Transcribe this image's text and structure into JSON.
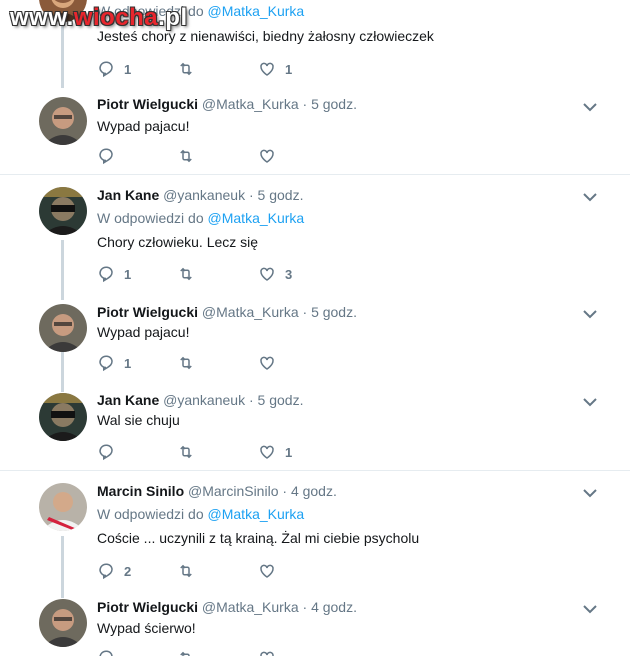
{
  "watermark": {
    "prefix": "www.",
    "accent": "wiocha",
    "suffix": ".pl"
  },
  "top_partial": {
    "reply_prefix": "W odpowiedzi do",
    "reply_mention": "@Matka_Kurka",
    "text": "Jesteś chory z nienawiści, biedny żałosny człowieczek",
    "reply_count": "1",
    "retweet_count": "",
    "like_count": "1"
  },
  "tweets": [
    {
      "name": "Piotr Wielgucki",
      "handle": "@Matka_Kurka",
      "dot": "·",
      "time": "5 godz.",
      "reply_prefix": "",
      "reply_mention": "",
      "text": "Wypad pajacu!",
      "reply_count": "",
      "retweet_count": "",
      "like_count": ""
    },
    {
      "name": "Jan Kane",
      "handle": "@yankaneuk",
      "dot": "·",
      "time": "5 godz.",
      "reply_prefix": "W odpowiedzi do",
      "reply_mention": "@Matka_Kurka",
      "text": "Chory człowieku. Lecz się",
      "reply_count": "1",
      "retweet_count": "",
      "like_count": "3"
    },
    {
      "name": "Piotr Wielgucki",
      "handle": "@Matka_Kurka",
      "dot": "·",
      "time": "5 godz.",
      "reply_prefix": "",
      "reply_mention": "",
      "text": "Wypad pajacu!",
      "reply_count": "1",
      "retweet_count": "",
      "like_count": ""
    },
    {
      "name": "Jan Kane",
      "handle": "@yankaneuk",
      "dot": "·",
      "time": "5 godz.",
      "reply_prefix": "",
      "reply_mention": "",
      "text": "Wal sie chuju",
      "reply_count": "",
      "retweet_count": "",
      "like_count": "1"
    },
    {
      "name": "Marcin Sinilo",
      "handle": "@MarcinSinilo",
      "dot": "·",
      "time": "4 godz.",
      "reply_prefix": "W odpowiedzi do",
      "reply_mention": "@Matka_Kurka",
      "text": "Coście ... uczynili z tą krainą. Żal mi ciebie psycholu",
      "reply_count": "2",
      "retweet_count": "",
      "like_count": ""
    },
    {
      "name": "Piotr Wielgucki",
      "handle": "@Matka_Kurka",
      "dot": "·",
      "time": "4 godz.",
      "reply_prefix": "",
      "reply_mention": "",
      "text": "Wypad ścierwo!",
      "reply_count": "",
      "retweet_count": "",
      "like_count": ""
    }
  ],
  "colors": {
    "link": "#1da1f2",
    "muted": "#657786",
    "thread_line": "#ccd6dd",
    "separator": "#e6ecf0"
  },
  "icons": [
    "reply-icon",
    "retweet-icon",
    "like-icon",
    "chevron-down-icon"
  ]
}
